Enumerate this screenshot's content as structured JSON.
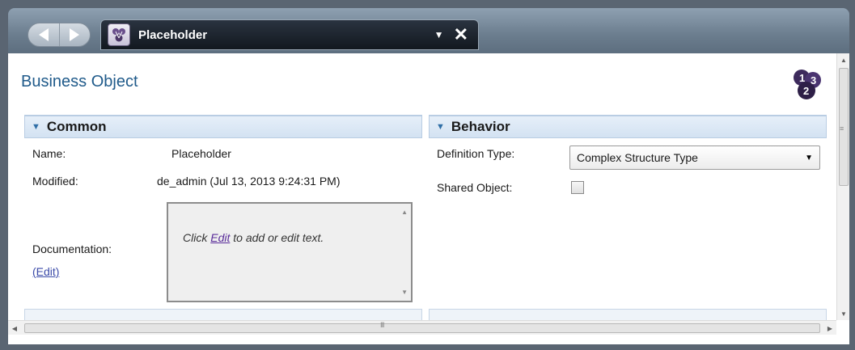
{
  "window": {
    "tab_title": "Placeholder",
    "tab_dropdown_glyph": "▼",
    "tab_close_glyph": "✕",
    "tab_icon": "business-object-icon"
  },
  "page": {
    "title": "Business Object",
    "badge_icon": "numbered-steps-icon"
  },
  "common": {
    "title": "Common",
    "name_label": "Name:",
    "name_value": "Placeholder",
    "modified_label": "Modified:",
    "modified_value": "de_admin (Jul 13, 2013 9:24:31 PM)",
    "documentation_label": "Documentation:",
    "documentation_edit_link": "(Edit)",
    "doc_hint_prefix": "Click ",
    "doc_hint_link": "Edit",
    "doc_hint_suffix": " to add or edit text."
  },
  "behavior": {
    "title": "Behavior",
    "definition_type_label": "Definition Type:",
    "definition_type_value": "Complex Structure Type",
    "shared_object_label": "Shared Object:",
    "shared_object_checked": false
  },
  "scrollbar": {
    "h_grip": "III",
    "v_grip": "≡"
  },
  "colors": {
    "title_blue": "#1f5a8a",
    "section_header_bg": "#dce8f5",
    "tab_bg": "#12181f"
  }
}
